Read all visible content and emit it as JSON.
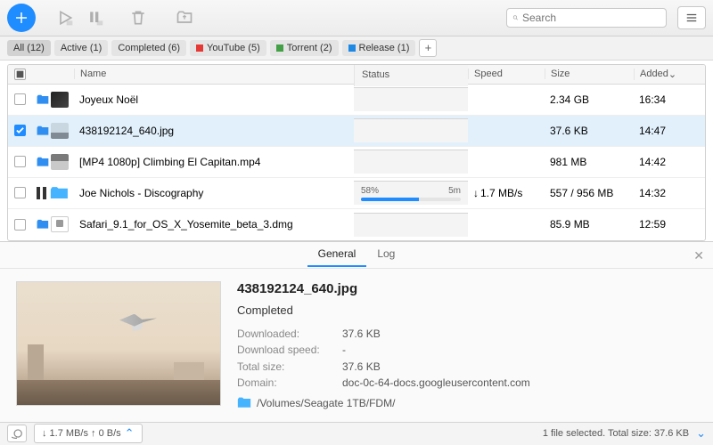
{
  "search": {
    "placeholder": "Search"
  },
  "filters": [
    {
      "label": "All (12)",
      "active": true
    },
    {
      "label": "Active (1)"
    },
    {
      "label": "Completed (6)"
    },
    {
      "label": "YouTube (5)",
      "color": "red"
    },
    {
      "label": "Torrent (2)",
      "color": "green"
    },
    {
      "label": "Release (1)",
      "color": "blue"
    }
  ],
  "columns": {
    "name": "Name",
    "status": "Status",
    "speed": "Speed",
    "size": "Size",
    "added": "Added"
  },
  "rows": [
    {
      "name": "Joyeux Noël",
      "status": "",
      "speed": "",
      "size": "2.34 GB",
      "added": "16:34"
    },
    {
      "name": "438192124_640.jpg",
      "status": "",
      "speed": "",
      "size": "37.6 KB",
      "added": "14:47",
      "selected": true
    },
    {
      "name": "[MP4 1080p] Climbing El Capitan.mp4",
      "status": "",
      "speed": "",
      "size": "981 MB",
      "added": "14:42"
    },
    {
      "name": "Joe Nichols - Discography",
      "status_pct": "58%",
      "status_eta": "5m",
      "progress": 58,
      "speed": "1.7 MB/s",
      "size": "557 / 956 MB",
      "added": "14:32",
      "paused_icon": true
    },
    {
      "name": "Safari_9.1_for_OS_X_Yosemite_beta_3.dmg",
      "status": "",
      "speed": "",
      "size": "85.9 MB",
      "added": "12:59"
    }
  ],
  "detail": {
    "tabs": {
      "general": "General",
      "log": "Log"
    },
    "title": "438192124_640.jpg",
    "state": "Completed",
    "fields": {
      "downloaded_k": "Downloaded:",
      "downloaded_v": "37.6 KB",
      "speed_k": "Download speed:",
      "speed_v": "-",
      "total_k": "Total size:",
      "total_v": "37.6 KB",
      "domain_k": "Domain:",
      "domain_v": "doc-0c-64-docs.googleusercontent.com"
    },
    "path": "/Volumes/Seagate 1TB/FDM/"
  },
  "statusbar": {
    "speeds": "↓ 1.7 MB/s ↑ 0 B/s",
    "summary": "1 file selected. Total size: 37.6 KB"
  }
}
